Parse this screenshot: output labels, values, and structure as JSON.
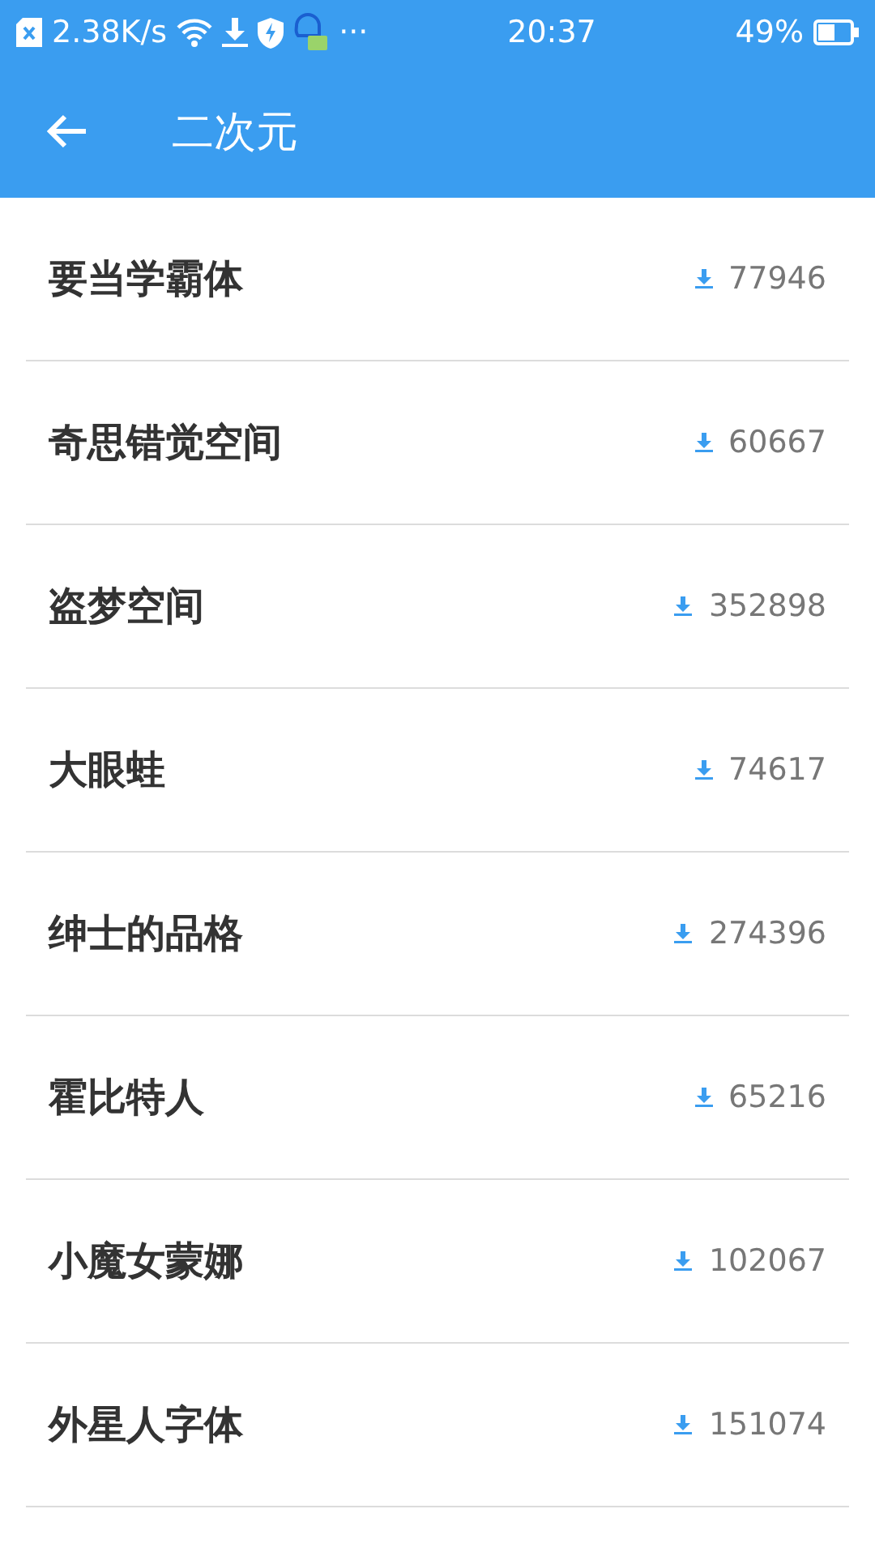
{
  "status_bar": {
    "speed": "2.38K/s",
    "more": "···",
    "time": "20:37",
    "battery": "49%"
  },
  "header": {
    "title": "二次元"
  },
  "fonts": [
    {
      "name": "要当学霸体",
      "downloads": "77946"
    },
    {
      "name": "奇思错觉空间",
      "downloads": "60667"
    },
    {
      "name": "盗梦空间",
      "downloads": "352898"
    },
    {
      "name": "大眼蛙",
      "downloads": "74617"
    },
    {
      "name": "绅士的品格",
      "downloads": "274396"
    },
    {
      "name": "霍比特人",
      "downloads": "65216"
    },
    {
      "name": "小魔女蒙娜",
      "downloads": "102067"
    },
    {
      "name": "外星人字体",
      "downloads": "151074"
    }
  ]
}
